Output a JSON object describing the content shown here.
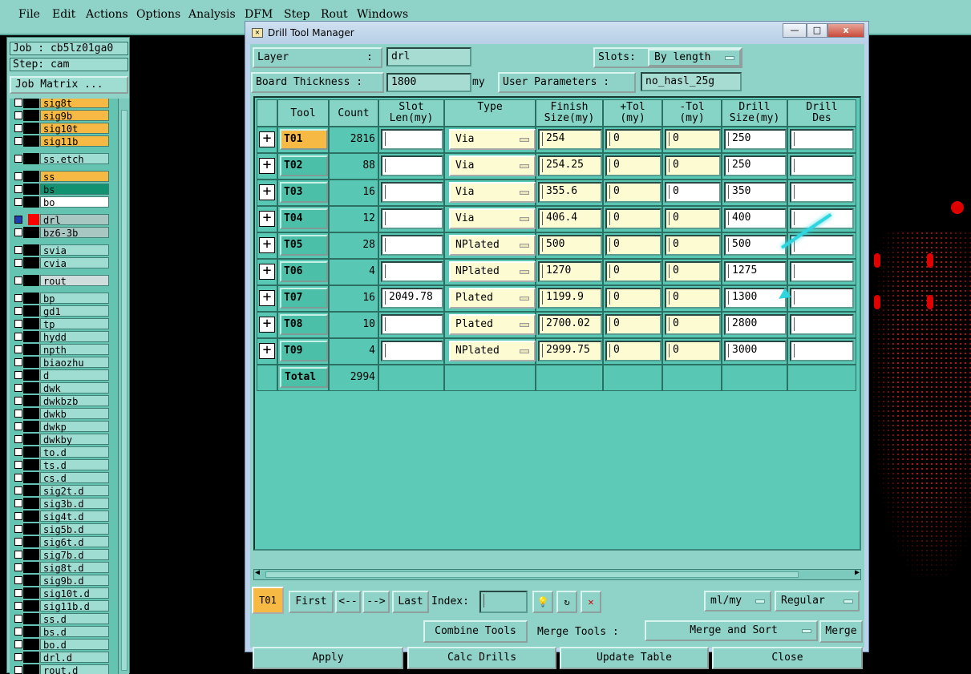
{
  "menu": [
    "File",
    "Edit",
    "Actions",
    "Options",
    "Analysis",
    "DFM",
    "Step",
    "Rout",
    "Windows"
  ],
  "job": "Job : cb5lz01ga0",
  "step": "Step: cam",
  "job_matrix": "Job Matrix ...",
  "layers": [
    "sig8t",
    "sig9b",
    "sig10t",
    "sig11b",
    "ss.etch",
    "ss",
    "bs",
    "bo",
    "drl",
    "bz6-3b",
    "svia",
    "cvia",
    "rout",
    "bp",
    "gd1",
    "tp",
    "hydd",
    "npth",
    "biaozhu",
    "d",
    "dwk",
    "dwkbzb",
    "dwkb",
    "dwkp",
    "dwkby",
    "to.d",
    "ts.d",
    "cs.d",
    "sig2t.d",
    "sig3b.d",
    "sig4t.d",
    "sig5b.d",
    "sig6t.d",
    "sig7b.d",
    "sig8t.d",
    "sig9b.d",
    "sig10t.d",
    "sig11b.d",
    "ss.d",
    "bs.d",
    "bo.d",
    "drl.d",
    "rout.d"
  ],
  "dialog": {
    "title": "Drill Tool Manager",
    "window_buttons": [
      "—",
      "□",
      "x"
    ],
    "layer_label": "Layer",
    "layer_sep": ":",
    "layer_value": "drl",
    "slots_label": "Slots:",
    "slots_value": "By length",
    "thickness_label": "Board Thickness :",
    "thickness_value": "1800",
    "thickness_unit": "my",
    "user_params_label": "User Parameters :",
    "user_params_value": "no_hasl_25g",
    "headers": [
      "Tool",
      "Count",
      "Slot\nLen(my)",
      "Type",
      "Finish\nSize(my)",
      "+Tol\n(my)",
      "-Tol\n(my)",
      "Drill\nSize(my)",
      "Drill\nDes"
    ],
    "rows": [
      {
        "tool": "T01",
        "count": "2816",
        "slot": "",
        "type": "Via",
        "finish": "254",
        "ptol": "0",
        "mtol": "0",
        "drill": "250",
        "des": ""
      },
      {
        "tool": "T02",
        "count": "88",
        "slot": "",
        "type": "Via",
        "finish": "254.25",
        "ptol": "0",
        "mtol": "0",
        "drill": "250",
        "des": ""
      },
      {
        "tool": "T03",
        "count": "16",
        "slot": "",
        "type": "Via",
        "finish": "355.6",
        "ptol": "0",
        "mtol": "0",
        "drill": "350",
        "des": ""
      },
      {
        "tool": "T04",
        "count": "12",
        "slot": "",
        "type": "Via",
        "finish": "406.4",
        "ptol": "0",
        "mtol": "0",
        "drill": "400",
        "des": ""
      },
      {
        "tool": "T05",
        "count": "28",
        "slot": "",
        "type": "NPlated",
        "finish": "500",
        "ptol": "0",
        "mtol": "0",
        "drill": "500",
        "des": ""
      },
      {
        "tool": "T06",
        "count": "4",
        "slot": "",
        "type": "NPlated",
        "finish": "1270",
        "ptol": "0",
        "mtol": "0",
        "drill": "1275",
        "des": ""
      },
      {
        "tool": "T07",
        "count": "16",
        "slot": "2049.78",
        "type": "Plated",
        "finish": "1199.9",
        "ptol": "0",
        "mtol": "0",
        "drill": "1300",
        "des": ""
      },
      {
        "tool": "T08",
        "count": "10",
        "slot": "",
        "type": "Plated",
        "finish": "2700.02",
        "ptol": "0",
        "mtol": "0",
        "drill": "2800",
        "des": ""
      },
      {
        "tool": "T09",
        "count": "4",
        "slot": "",
        "type": "NPlated",
        "finish": "2999.75",
        "ptol": "0",
        "mtol": "0",
        "drill": "3000",
        "des": ""
      }
    ],
    "total_label": "Total",
    "total_count": "2994",
    "current_tool": "T01",
    "nav": [
      "First",
      "<--",
      "-->",
      "Last"
    ],
    "index_label": "Index:",
    "units": "ml/my",
    "mode": "Regular",
    "combine_tools": "Combine Tools",
    "merge_tools_label": "Merge Tools :",
    "merge_mode": "Merge and Sort",
    "merge_btn": "Merge",
    "bottom": [
      "Apply",
      "Calc Drills",
      "Update Table",
      "Close"
    ]
  }
}
